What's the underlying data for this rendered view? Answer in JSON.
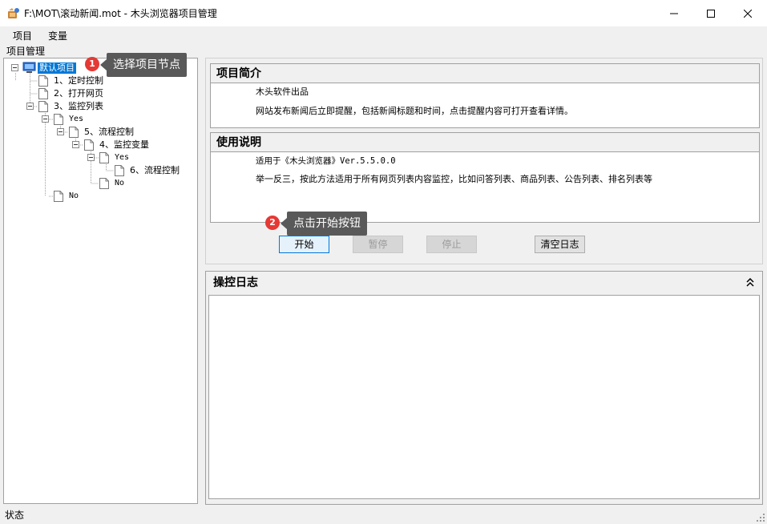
{
  "window": {
    "title": "F:\\MOT\\滚动新闻.mot  - 木头浏览器项目管理",
    "icon": "app-logo-icon",
    "controls": [
      "minimize-icon",
      "maximize-icon",
      "close-icon"
    ]
  },
  "menu": {
    "items": [
      "项目",
      "变量"
    ]
  },
  "tree": {
    "title": "项目管理",
    "nodes": [
      "默认项目",
      "1、定时控制",
      "2、打开网页",
      "3、监控列表",
      "Yes",
      "5、流程控制",
      "4、监控变量",
      "Yes",
      "6、流程控制",
      "No",
      "No"
    ]
  },
  "intro": {
    "title": "项目简介",
    "lines": [
      "木头软件出品",
      "网站发布新闻后立即提醒，包括新闻标题和时间，点击提醒内容可打开查看详情。"
    ]
  },
  "usage": {
    "title": "使用说明",
    "lines": [
      "适用于《木头浏览器》Ver.5.5.0.0",
      "举一反三，按此方法适用于所有网页列表内容监控，比如问答列表、商品列表、公告列表、排名列表等"
    ]
  },
  "buttons": {
    "start": "开始",
    "pause": "暂停",
    "stop": "停止",
    "clear": "清空日志"
  },
  "log": {
    "title": "操控日志"
  },
  "status": {
    "text": "状态"
  },
  "callouts": [
    {
      "number": "1",
      "text": "选择项目节点"
    },
    {
      "number": "2",
      "text": "点击开始按钮"
    }
  ],
  "colors": {
    "selection": "#0078d7",
    "callout_bg": "#595959",
    "badge": "#e53935"
  }
}
